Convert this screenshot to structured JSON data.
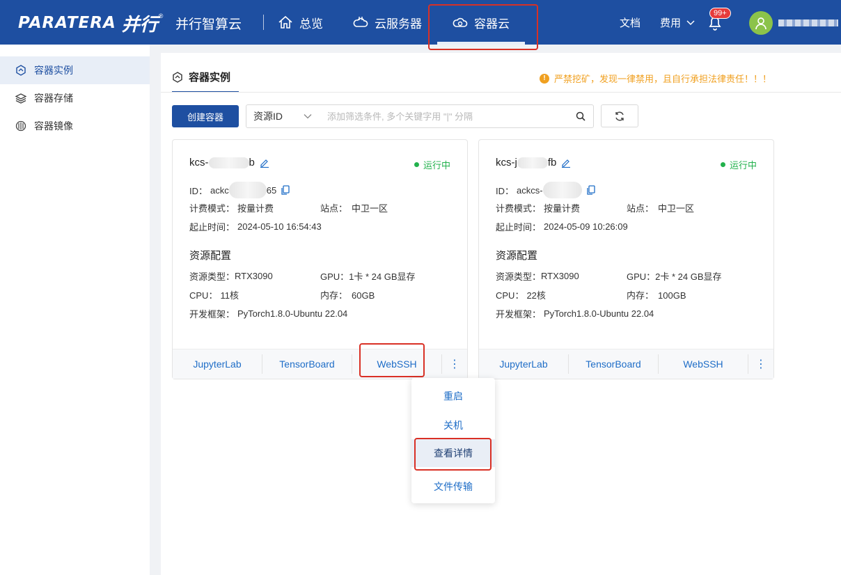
{
  "brand": {
    "logo_en": "PARATERA",
    "logo_cn": "并行",
    "logo_reg": "®",
    "product_name": "并行智算云"
  },
  "nav": {
    "items": [
      {
        "label": "总览",
        "icon": "home-icon"
      },
      {
        "label": "云服务器",
        "icon": "cloud-server-icon"
      },
      {
        "label": "容器云",
        "icon": "container-cloud-icon",
        "active": true
      }
    ]
  },
  "header_right": {
    "docs": "文档",
    "billing": "费用",
    "notifications_badge": "99+"
  },
  "sidebar": {
    "items": [
      {
        "label": "容器实例",
        "icon": "container-instance-icon",
        "active": true
      },
      {
        "label": "容器存储",
        "icon": "layers-icon"
      },
      {
        "label": "容器镜像",
        "icon": "disc-icon"
      }
    ]
  },
  "page": {
    "tab_title": "容器实例",
    "warning": "严禁挖矿，发现一律禁用，且自行承担法律责任！！！",
    "warning_icon": "!",
    "create_button": "创建容器",
    "filter_select": "资源ID",
    "filter_placeholder": "添加筛选条件, 多个关键字用 \"|\" 分隔"
  },
  "cards": [
    {
      "name_prefix": "kcs-",
      "name_suffix": "b",
      "status": "运行中",
      "id_label": "ID：",
      "id_prefix": "ackc",
      "id_suffix": "65",
      "billing_label": "计费模式：",
      "billing": "按量计费",
      "site_label": "站点：",
      "site": "中卫一区",
      "time_label": "起止时间：",
      "time": "2024-05-10 16:54:43",
      "section": "资源配置",
      "type_label": "资源类型：",
      "type": "RTX3090",
      "gpu_label": "GPU：",
      "gpu": "1卡 * 24 GB显存",
      "cpu_label": "CPU：",
      "cpu": "11核",
      "mem_label": "内存：",
      "mem": "60GB",
      "framework_label": "开发框架：",
      "framework": "PyTorch1.8.0-Ubuntu 22.04",
      "actions": [
        "JupyterLab",
        "TensorBoard",
        "WebSSH"
      ],
      "more": "⋮"
    },
    {
      "name_prefix": "kcs-j",
      "name_suffix": "fb",
      "status": "运行中",
      "id_label": "ID：",
      "id_prefix": "ackcs-",
      "id_suffix": "",
      "billing_label": "计费模式：",
      "billing": "按量计费",
      "site_label": "站点：",
      "site": "中卫一区",
      "time_label": "起止时间：",
      "time": "2024-05-09 10:26:09",
      "section": "资源配置",
      "type_label": "资源类型：",
      "type": "RTX3090",
      "gpu_label": "GPU：",
      "gpu": "2卡 * 24 GB显存",
      "cpu_label": "CPU：",
      "cpu": "22核",
      "mem_label": "内存：",
      "mem": "100GB",
      "framework_label": "开发框架：",
      "framework": "PyTorch1.8.0-Ubuntu 22.04",
      "actions": [
        "JupyterLab",
        "TensorBoard",
        "WebSSH"
      ],
      "more": "⋮"
    }
  ],
  "dropdown": {
    "items": [
      "重启",
      "关机",
      "查看详情",
      "文件传输"
    ]
  },
  "colors": {
    "brand": "#1e4fa1",
    "link": "#1e6dc7",
    "running": "#22b14c",
    "warning": "#f0a020",
    "highlight": "#d93025"
  }
}
